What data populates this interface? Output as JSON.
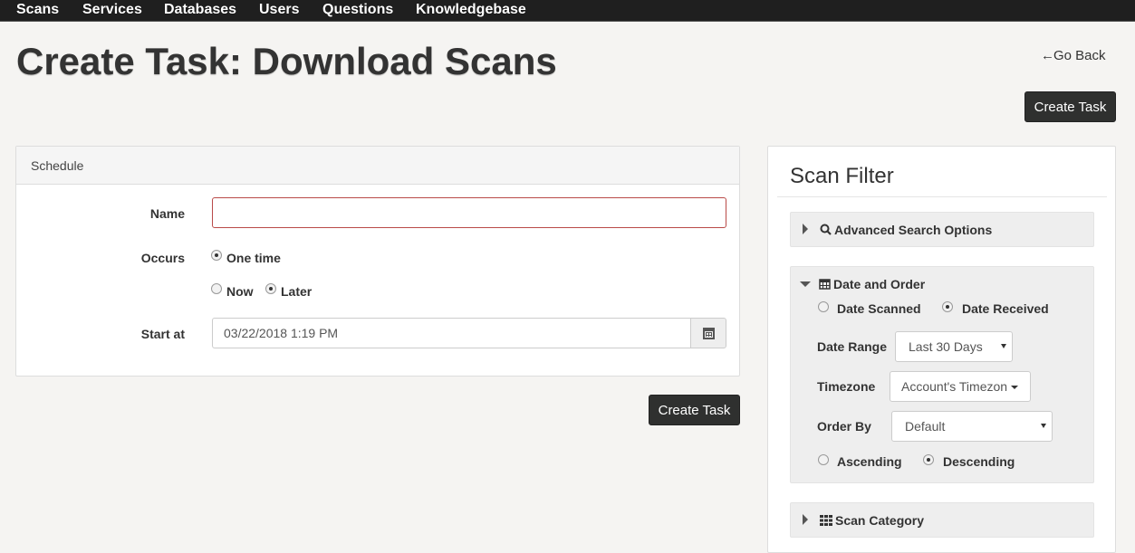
{
  "nav": {
    "items": [
      {
        "label": "Scans"
      },
      {
        "label": "Services"
      },
      {
        "label": "Databases"
      },
      {
        "label": "Users"
      },
      {
        "label": "Questions"
      },
      {
        "label": "Knowledgebase"
      }
    ]
  },
  "page": {
    "title": "Create Task: Download Scans",
    "go_back_label": "Go Back",
    "go_back_icon": "arrow-left-icon",
    "create_task_label": "Create Task"
  },
  "schedule": {
    "heading": "Schedule",
    "name_label": "Name",
    "name_value": "",
    "occurs_label": "Occurs",
    "occurs_options": {
      "one_time": "One time",
      "now": "Now",
      "later": "Later"
    },
    "occurs_selected": "one_time",
    "when_selected": "later",
    "start_at_label": "Start at",
    "start_at_value": "03/22/2018 1:19 PM",
    "calendar_icon": "calendar-icon",
    "create_task_label": "Create Task"
  },
  "filter": {
    "title": "Scan Filter",
    "advanced": {
      "label": "Advanced Search Options",
      "icon": "search-icon",
      "expanded": false
    },
    "date_order": {
      "label": "Date and Order",
      "icon": "calendar-icon",
      "expanded": true,
      "date_type_options": {
        "scanned": "Date Scanned",
        "received": "Date Received"
      },
      "date_type_selected": "received",
      "date_range_label": "Date Range",
      "date_range_value": "Last 30 Days",
      "timezone_label": "Timezone",
      "timezone_value": "Account's Timezon",
      "order_by_label": "Order By",
      "order_by_value": "Default",
      "direction_options": {
        "asc": "Ascending",
        "desc": "Descending"
      },
      "direction_selected": "desc"
    },
    "category": {
      "label": "Scan Category",
      "icon": "grid-icon",
      "expanded": false
    }
  }
}
